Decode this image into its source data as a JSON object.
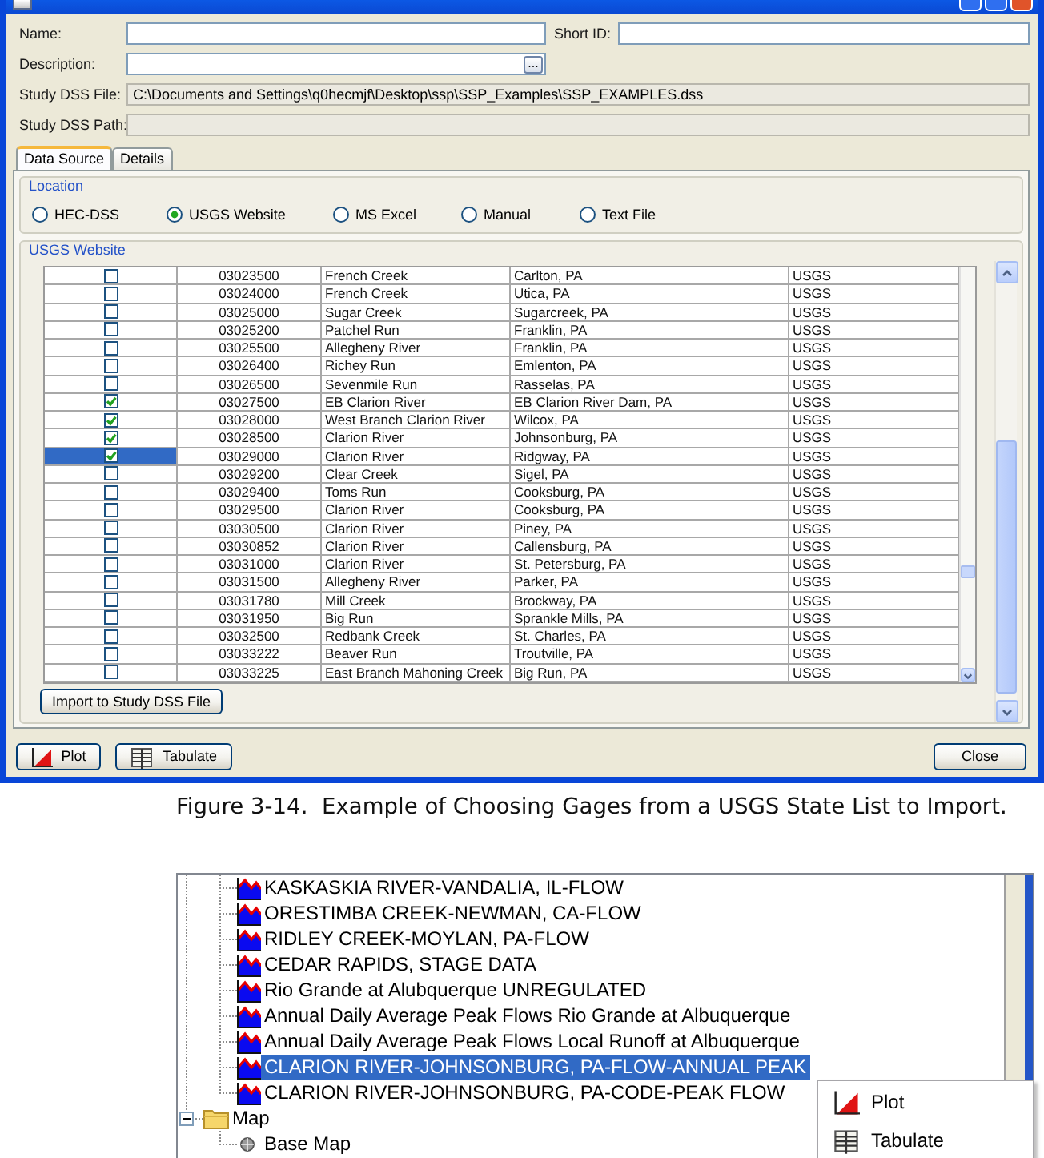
{
  "window": {
    "fields": [
      {
        "label": "Name:",
        "kind": "input"
      },
      {
        "label": "Short ID:",
        "kind": "input"
      },
      {
        "label": "Description:",
        "kind": "browse",
        "button": "..."
      },
      {
        "label": "Study DSS File:",
        "kind": "readonly",
        "value": "C:\\Documents and Settings\\q0hecmjf\\Desktop\\ssp\\SSP_Examples\\SSP_EXAMPLES.dss"
      },
      {
        "label": "Study DSS Path:",
        "kind": "readonly"
      }
    ],
    "tabs": [
      {
        "label": "Data Source",
        "selected": true
      },
      {
        "label": "Details",
        "selected": false
      }
    ],
    "location": {
      "title": "Location",
      "options": [
        {
          "label": "HEC-DSS",
          "selected": false
        },
        {
          "label": "USGS Website",
          "selected": true
        },
        {
          "label": "MS Excel",
          "selected": false
        },
        {
          "label": "Manual",
          "selected": false
        },
        {
          "label": "Text File",
          "selected": false
        }
      ]
    },
    "usgs_website": {
      "title": "USGS Website",
      "table": {
        "rows": [
          {
            "checked": false,
            "selected": false,
            "cells": [
              "03023500",
              "French Creek",
              "Carlton, PA",
              "USGS"
            ]
          },
          {
            "checked": false,
            "selected": false,
            "cells": [
              "03024000",
              "French Creek",
              "Utica, PA",
              "USGS"
            ]
          },
          {
            "checked": false,
            "selected": false,
            "cells": [
              "03025000",
              "Sugar Creek",
              "Sugarcreek, PA",
              "USGS"
            ]
          },
          {
            "checked": false,
            "selected": false,
            "cells": [
              "03025200",
              "Patchel Run",
              "Franklin, PA",
              "USGS"
            ]
          },
          {
            "checked": false,
            "selected": false,
            "cells": [
              "03025500",
              "Allegheny River",
              "Franklin, PA",
              "USGS"
            ]
          },
          {
            "checked": false,
            "selected": false,
            "cells": [
              "03026400",
              "Richey Run",
              "Emlenton, PA",
              "USGS"
            ]
          },
          {
            "checked": false,
            "selected": false,
            "cells": [
              "03026500",
              "Sevenmile Run",
              "Rasselas, PA",
              "USGS"
            ]
          },
          {
            "checked": true,
            "selected": false,
            "cells": [
              "03027500",
              "EB Clarion River",
              "EB Clarion River Dam, PA",
              "USGS"
            ]
          },
          {
            "checked": true,
            "selected": false,
            "cells": [
              "03028000",
              "West Branch Clarion River",
              "Wilcox, PA",
              "USGS"
            ]
          },
          {
            "checked": true,
            "selected": false,
            "cells": [
              "03028500",
              "Clarion River",
              "Johnsonburg, PA",
              "USGS"
            ]
          },
          {
            "checked": true,
            "selected": true,
            "cells": [
              "03029000",
              "Clarion River",
              "Ridgway, PA",
              "USGS"
            ]
          },
          {
            "checked": false,
            "selected": false,
            "cells": [
              "03029200",
              "Clear Creek",
              "Sigel, PA",
              "USGS"
            ]
          },
          {
            "checked": false,
            "selected": false,
            "cells": [
              "03029400",
              "Toms Run",
              "Cooksburg, PA",
              "USGS"
            ]
          },
          {
            "checked": false,
            "selected": false,
            "cells": [
              "03029500",
              "Clarion River",
              "Cooksburg, PA",
              "USGS"
            ]
          },
          {
            "checked": false,
            "selected": false,
            "cells": [
              "03030500",
              "Clarion River",
              "Piney, PA",
              "USGS"
            ]
          },
          {
            "checked": false,
            "selected": false,
            "cells": [
              "03030852",
              "Clarion River",
              "Callensburg, PA",
              "USGS"
            ]
          },
          {
            "checked": false,
            "selected": false,
            "cells": [
              "03031000",
              "Clarion River",
              "St. Petersburg, PA",
              "USGS"
            ]
          },
          {
            "checked": false,
            "selected": false,
            "cells": [
              "03031500",
              "Allegheny River",
              "Parker, PA",
              "USGS"
            ]
          },
          {
            "checked": false,
            "selected": false,
            "cells": [
              "03031780",
              "Mill Creek",
              "Brockway, PA",
              "USGS"
            ]
          },
          {
            "checked": false,
            "selected": false,
            "cells": [
              "03031950",
              "Big Run",
              "Sprankle Mills, PA",
              "USGS"
            ]
          },
          {
            "checked": false,
            "selected": false,
            "cells": [
              "03032500",
              "Redbank Creek",
              "St. Charles, PA",
              "USGS"
            ]
          },
          {
            "checked": false,
            "selected": false,
            "cells": [
              "03033222",
              "Beaver Run",
              "Troutville, PA",
              "USGS"
            ]
          },
          {
            "checked": false,
            "selected": false,
            "cells": [
              "03033225",
              "East Branch Mahoning Creek",
              "Big Run, PA",
              "USGS"
            ]
          }
        ]
      },
      "import_button": "Import to Study DSS File"
    },
    "buttons": [
      {
        "label": "Plot",
        "kind": "plot"
      },
      {
        "label": "Tabulate",
        "kind": "tabulate"
      },
      {
        "label": "Close",
        "kind": "plain"
      }
    ]
  },
  "caption": "Figure 3-14.  Example of Choosing Gages from a USGS State List to Import.",
  "tree": {
    "items": [
      {
        "children": [
          {
            "label": "KASKASKIA RIVER-VANDALIA, IL-FLOW",
            "kind": "dataset",
            "selected": false
          },
          {
            "label": "ORESTIMBA CREEK-NEWMAN, CA-FLOW",
            "kind": "dataset",
            "selected": false
          },
          {
            "label": "RIDLEY CREEK-MOYLAN, PA-FLOW",
            "kind": "dataset",
            "selected": false
          },
          {
            "label": "CEDAR RAPIDS, STAGE DATA",
            "kind": "dataset",
            "selected": false
          },
          {
            "label": "Rio Grande at Alubquerque UNREGULATED",
            "kind": "dataset",
            "selected": false
          },
          {
            "label": "Annual Daily Average Peak Flows Rio Grande at Albuquerque",
            "kind": "dataset",
            "selected": false
          },
          {
            "label": "Annual Daily Average Peak Flows Local Runoff at Albuquerque",
            "kind": "dataset",
            "selected": false
          },
          {
            "label": "CLARION RIVER-JOHNSONBURG, PA-FLOW-ANNUAL PEAK",
            "kind": "dataset",
            "selected": true
          },
          {
            "label": "CLARION RIVER-JOHNSONBURG, PA-CODE-PEAK FLOW",
            "kind": "dataset",
            "selected": false
          }
        ]
      },
      {
        "label": "Map",
        "kind": "folder",
        "expanded": true,
        "selected": false,
        "children": [
          {
            "label": "Base Map",
            "kind": "map",
            "selected": false
          }
        ]
      }
    ]
  },
  "context_menu": {
    "items": [
      {
        "label": "Plot",
        "kind": "plot"
      },
      {
        "label": "Tabulate",
        "kind": "tabulate"
      }
    ]
  }
}
